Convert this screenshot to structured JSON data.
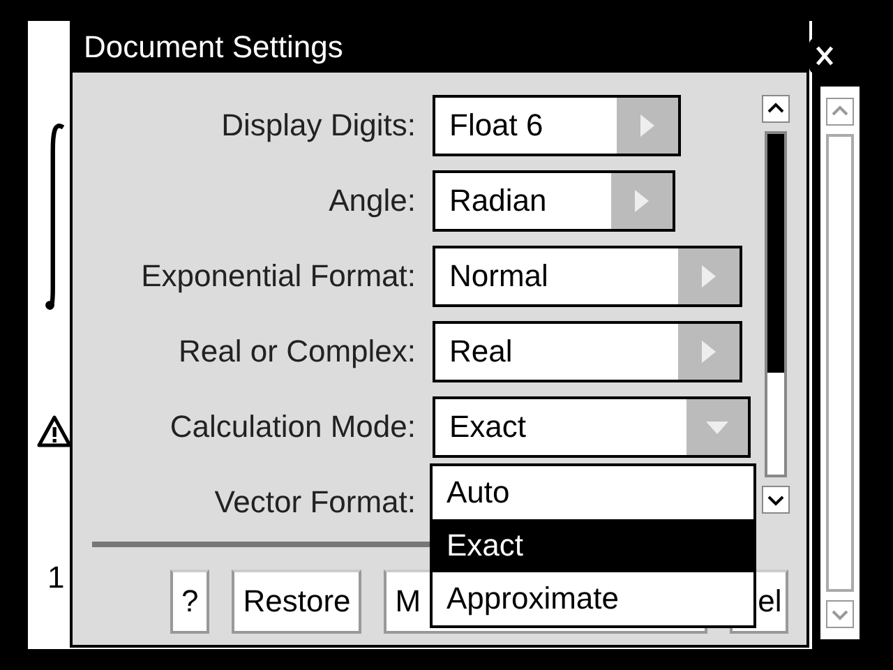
{
  "window": {
    "title": "Document Settings"
  },
  "settings": [
    {
      "label": "Display Digits:",
      "value": "Float 6",
      "kind": "spinner"
    },
    {
      "label": "Angle:",
      "value": "Radian",
      "kind": "spinner"
    },
    {
      "label": "Exponential Format:",
      "value": "Normal",
      "kind": "spinner"
    },
    {
      "label": "Real or Complex:",
      "value": "Real",
      "kind": "spinner"
    },
    {
      "label": "Calculation Mode:",
      "value": "Exact",
      "kind": "dropdown",
      "expanded": true
    },
    {
      "label": "Vector Format:",
      "kind": "covered"
    }
  ],
  "dropdown_options": [
    {
      "label": "Auto",
      "selected": false
    },
    {
      "label": "Exact",
      "selected": true
    },
    {
      "label": "Approximate",
      "selected": false
    }
  ],
  "buttons": [
    "?",
    "Restore",
    "M",
    "el"
  ],
  "background": {
    "line_number": "1"
  }
}
